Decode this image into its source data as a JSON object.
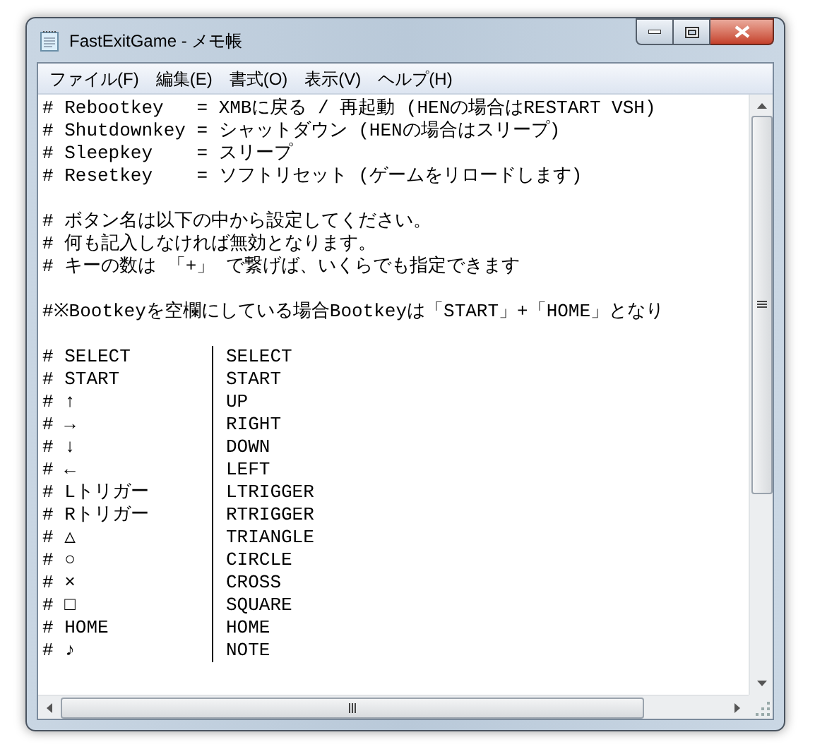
{
  "window": {
    "title": "FastExitGame - メモ帳"
  },
  "menu": [
    "ファイル(F)",
    "編集(E)",
    "書式(O)",
    "表示(V)",
    "ヘルプ(H)"
  ],
  "lines": [
    {
      "kind": "text",
      "text": "# Rebootkey   = XMBに戻る / 再起動 (HENの場合はRESTART VSH)"
    },
    {
      "kind": "text",
      "text": "# Shutdownkey = シャットダウン (HENの場合はスリープ)"
    },
    {
      "kind": "text",
      "text": "# Sleepkey    = スリープ"
    },
    {
      "kind": "text",
      "text": "# Resetkey    = ソフトリセット (ゲームをリロードします)"
    },
    {
      "kind": "blank"
    },
    {
      "kind": "text",
      "text": "# ボタン名は以下の中から設定してください。"
    },
    {
      "kind": "text",
      "text": "# 何も記入しなければ無効となります。"
    },
    {
      "kind": "text",
      "text": "# キーの数は 「+」 で繋げば、いくらでも指定できます"
    },
    {
      "kind": "blank"
    },
    {
      "kind": "text",
      "text": "#※Bootkeyを空欄にしている場合Bootkeyは「START」+「HOME」となり"
    },
    {
      "kind": "blank"
    },
    {
      "kind": "table",
      "left": "# SELECT",
      "right": "SELECT"
    },
    {
      "kind": "table",
      "left": "# START",
      "right": "START"
    },
    {
      "kind": "table",
      "left": "# ↑",
      "right": "UP"
    },
    {
      "kind": "table",
      "left": "# →",
      "right": "RIGHT"
    },
    {
      "kind": "table",
      "left": "# ↓",
      "right": "DOWN"
    },
    {
      "kind": "table",
      "left": "# ←",
      "right": "LEFT"
    },
    {
      "kind": "table",
      "left": "# Lトリガー",
      "right": "LTRIGGER"
    },
    {
      "kind": "table",
      "left": "# Rトリガー",
      "right": "RTRIGGER"
    },
    {
      "kind": "table",
      "left": "# △",
      "right": "TRIANGLE"
    },
    {
      "kind": "table",
      "left": "# ○",
      "right": "CIRCLE"
    },
    {
      "kind": "table",
      "left": "# ×",
      "right": "CROSS"
    },
    {
      "kind": "table",
      "left": "# □",
      "right": "SQUARE"
    },
    {
      "kind": "table",
      "left": "# HOME",
      "right": "HOME"
    },
    {
      "kind": "table",
      "left": "# ♪",
      "right": "NOTE"
    }
  ]
}
